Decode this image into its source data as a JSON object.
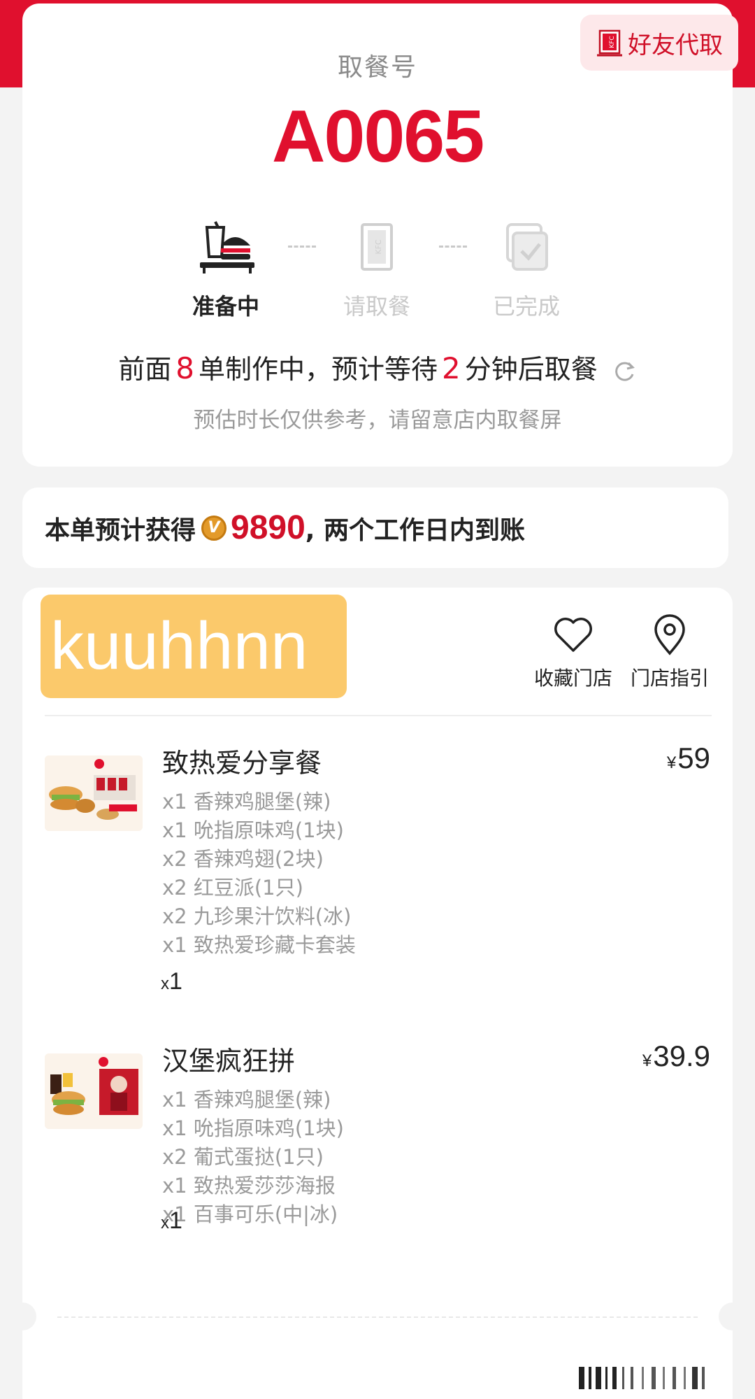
{
  "pickup": {
    "label": "取餐号",
    "number": "A0065",
    "friend_pickup": "好友代取",
    "steps": [
      {
        "label": "准备中",
        "state": "active"
      },
      {
        "label": "请取餐",
        "state": "inactive"
      },
      {
        "label": "已完成",
        "state": "inactive"
      }
    ],
    "wait": {
      "prefix": "前面",
      "orders_ahead": "8",
      "middle": "单制作中，预计等待",
      "minutes": "2",
      "suffix": "分钟后取餐"
    },
    "note": "预估时长仅供参考，请留意店内取餐屏"
  },
  "points": {
    "prefix": "本单预计获得",
    "value": "9890",
    "suffix": ", 两个工作日内到账"
  },
  "store": {
    "name": "kuuhhnn",
    "favorite_label": "收藏门店",
    "guide_label": "门店指引"
  },
  "items": [
    {
      "name": "致热爱分享餐",
      "currency": "¥",
      "price": "59",
      "subs": [
        "x1 香辣鸡腿堡(辣)",
        "x1 吮指原味鸡(1块)",
        "x2 香辣鸡翅(2块)",
        "x2 红豆派(1只)",
        "x2 九珍果汁饮料(冰)",
        "x1 致热爱珍藏卡套装"
      ],
      "qty_prefix": "x",
      "qty": "1"
    },
    {
      "name": "汉堡疯狂拼",
      "currency": "¥",
      "price": "39.9",
      "subs": [
        "x1 香辣鸡腿堡(辣)",
        "x1 吮指原味鸡(1块)",
        "x2 葡式蛋挞(1只)",
        "x1 致热爱莎莎海报",
        "x1 百事可乐(中|冰)"
      ],
      "qty_prefix": "x",
      "qty": "1"
    }
  ],
  "colors": {
    "brand_red": "#e0102e",
    "store_name_bg": "#fbc96b",
    "points_badge": "#e39a2a"
  }
}
